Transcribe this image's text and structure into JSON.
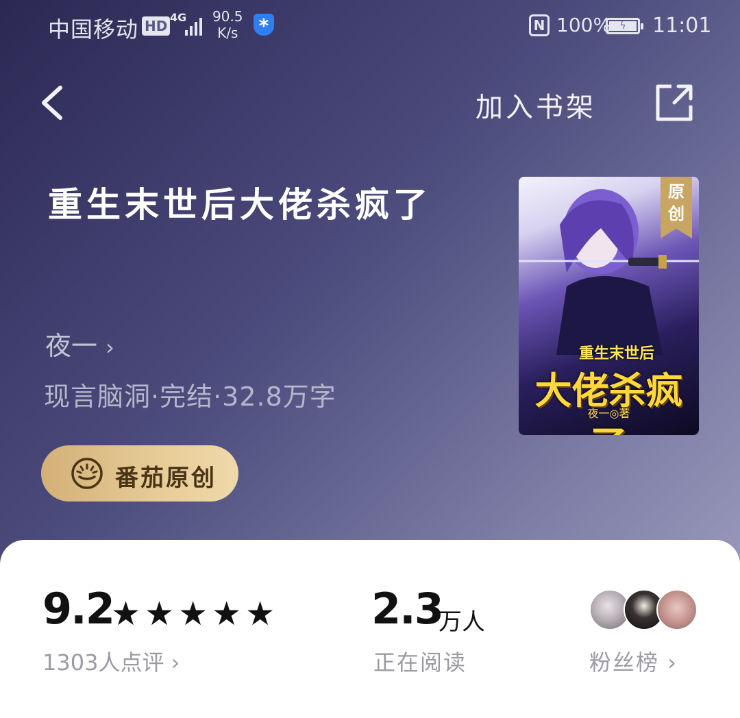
{
  "status_bar": {
    "carrier": "中国移动",
    "hd": "HD",
    "network": "4G",
    "speed_value": "90.5",
    "speed_unit": "K/s",
    "battery_percent": "100%",
    "time": "11:01"
  },
  "nav": {
    "add_to_shelf": "加入书架"
  },
  "book": {
    "title": "重生末世后大佬杀疯了",
    "author": "夜一",
    "meta": "现言脑洞·完结·32.8万字",
    "badge": "番茄原创"
  },
  "cover": {
    "ribbon": "原创",
    "subtitle": "重生末世后",
    "main_title": "大佬杀疯了",
    "author_line": "夜一◎著"
  },
  "stats": {
    "rating": "9.2",
    "stars": "★★★★★",
    "rating_count": "1303人点评",
    "readers": "2.3",
    "readers_unit": "万人",
    "readers_label": "正在阅读",
    "fans_label": "粉丝榜"
  },
  "colors": {
    "header_gradient_start": "#2c2854",
    "header_gradient_end": "#9898bb",
    "badge_gold": "#e7cc97",
    "cover_title_yellow": "#ffd93b"
  }
}
